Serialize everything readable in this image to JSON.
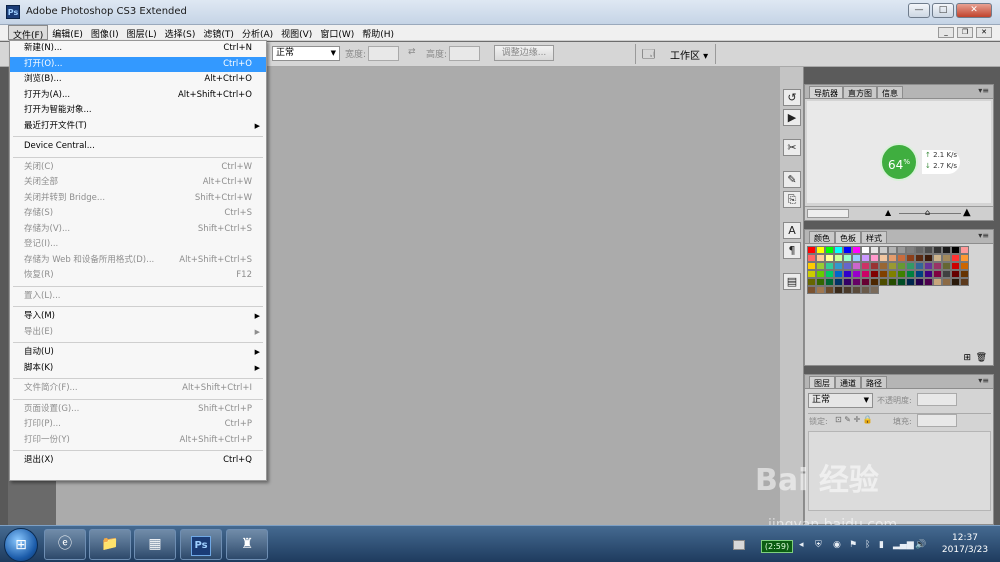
{
  "window": {
    "title": "Adobe Photoshop CS3 Extended",
    "app_icon": "Ps"
  },
  "menubar": [
    "文件(F)",
    "编辑(E)",
    "图像(I)",
    "图层(L)",
    "选择(S)",
    "滤镜(T)",
    "分析(A)",
    "视图(V)",
    "窗口(W)",
    "帮助(H)"
  ],
  "options": {
    "mode_value": "正常",
    "width_label": "宽度:",
    "height_label": "高度:",
    "refine_label": "调整边缘...",
    "workspace_label": "工作区 ▾"
  },
  "file_menu": [
    {
      "label": "新建(N)...",
      "shortcut": "Ctrl+N",
      "enabled": true
    },
    {
      "label": "打开(O)...",
      "shortcut": "Ctrl+O",
      "enabled": true,
      "highlighted": true
    },
    {
      "label": "浏览(B)...",
      "shortcut": "Alt+Ctrl+O",
      "enabled": true
    },
    {
      "label": "打开为(A)...",
      "shortcut": "Alt+Shift+Ctrl+O",
      "enabled": true
    },
    {
      "label": "打开为智能对象...",
      "shortcut": "",
      "enabled": true
    },
    {
      "label": "最近打开文件(T)",
      "shortcut": "",
      "enabled": true,
      "submenu": true
    },
    {
      "separator": true
    },
    {
      "label": "Device Central...",
      "shortcut": "",
      "enabled": true
    },
    {
      "separator": true
    },
    {
      "label": "关闭(C)",
      "shortcut": "Ctrl+W",
      "enabled": false
    },
    {
      "label": "关闭全部",
      "shortcut": "Alt+Ctrl+W",
      "enabled": false
    },
    {
      "label": "关闭并转到 Bridge...",
      "shortcut": "Shift+Ctrl+W",
      "enabled": false
    },
    {
      "label": "存储(S)",
      "shortcut": "Ctrl+S",
      "enabled": false
    },
    {
      "label": "存储为(V)...",
      "shortcut": "Shift+Ctrl+S",
      "enabled": false
    },
    {
      "label": "登记(I)...",
      "shortcut": "",
      "enabled": false
    },
    {
      "label": "存储为 Web 和设备所用格式(D)...",
      "shortcut": "Alt+Shift+Ctrl+S",
      "enabled": false
    },
    {
      "label": "恢复(R)",
      "shortcut": "F12",
      "enabled": false
    },
    {
      "separator": true
    },
    {
      "label": "置入(L)...",
      "shortcut": "",
      "enabled": false
    },
    {
      "separator": true
    },
    {
      "label": "导入(M)",
      "shortcut": "",
      "enabled": true,
      "submenu": true
    },
    {
      "label": "导出(E)",
      "shortcut": "",
      "enabled": false,
      "submenu": true
    },
    {
      "separator": true
    },
    {
      "label": "自动(U)",
      "shortcut": "",
      "enabled": true,
      "submenu": true
    },
    {
      "label": "脚本(K)",
      "shortcut": "",
      "enabled": true,
      "submenu": true
    },
    {
      "separator": true
    },
    {
      "label": "文件简介(F)...",
      "shortcut": "Alt+Shift+Ctrl+I",
      "enabled": false
    },
    {
      "separator": true
    },
    {
      "label": "页面设置(G)...",
      "shortcut": "Shift+Ctrl+P",
      "enabled": false
    },
    {
      "label": "打印(P)...",
      "shortcut": "Ctrl+P",
      "enabled": false
    },
    {
      "label": "打印一份(Y)",
      "shortcut": "Alt+Shift+Ctrl+P",
      "enabled": false
    },
    {
      "separator": true
    },
    {
      "label": "退出(X)",
      "shortcut": "Ctrl+Q",
      "enabled": true
    }
  ],
  "panels": {
    "navigator_tabs": [
      "导航器",
      "直方图",
      "信息"
    ],
    "swatch_tabs": [
      "颜色",
      "色板",
      "样式"
    ],
    "layer_tabs": [
      "图层",
      "通道",
      "路径"
    ],
    "layer_blend": "正常",
    "opacity_label": "不透明度:",
    "lock_label": "锁定:",
    "fill_label": "填充:"
  },
  "net_widget": {
    "percent": "64",
    "percent_sign": "%",
    "up": "2.1 K/s",
    "down": "2.7 K/s"
  },
  "taskbar": {
    "timer": "(2:59)",
    "time": "12:37",
    "date": "2017/3/23"
  },
  "watermark": {
    "main": "Bai 经验",
    "url": "jingyan.baidu.com"
  },
  "colors": {
    "highlight": "#3399ff",
    "canvas": "#ababab",
    "net_green": "#3fae3f"
  }
}
